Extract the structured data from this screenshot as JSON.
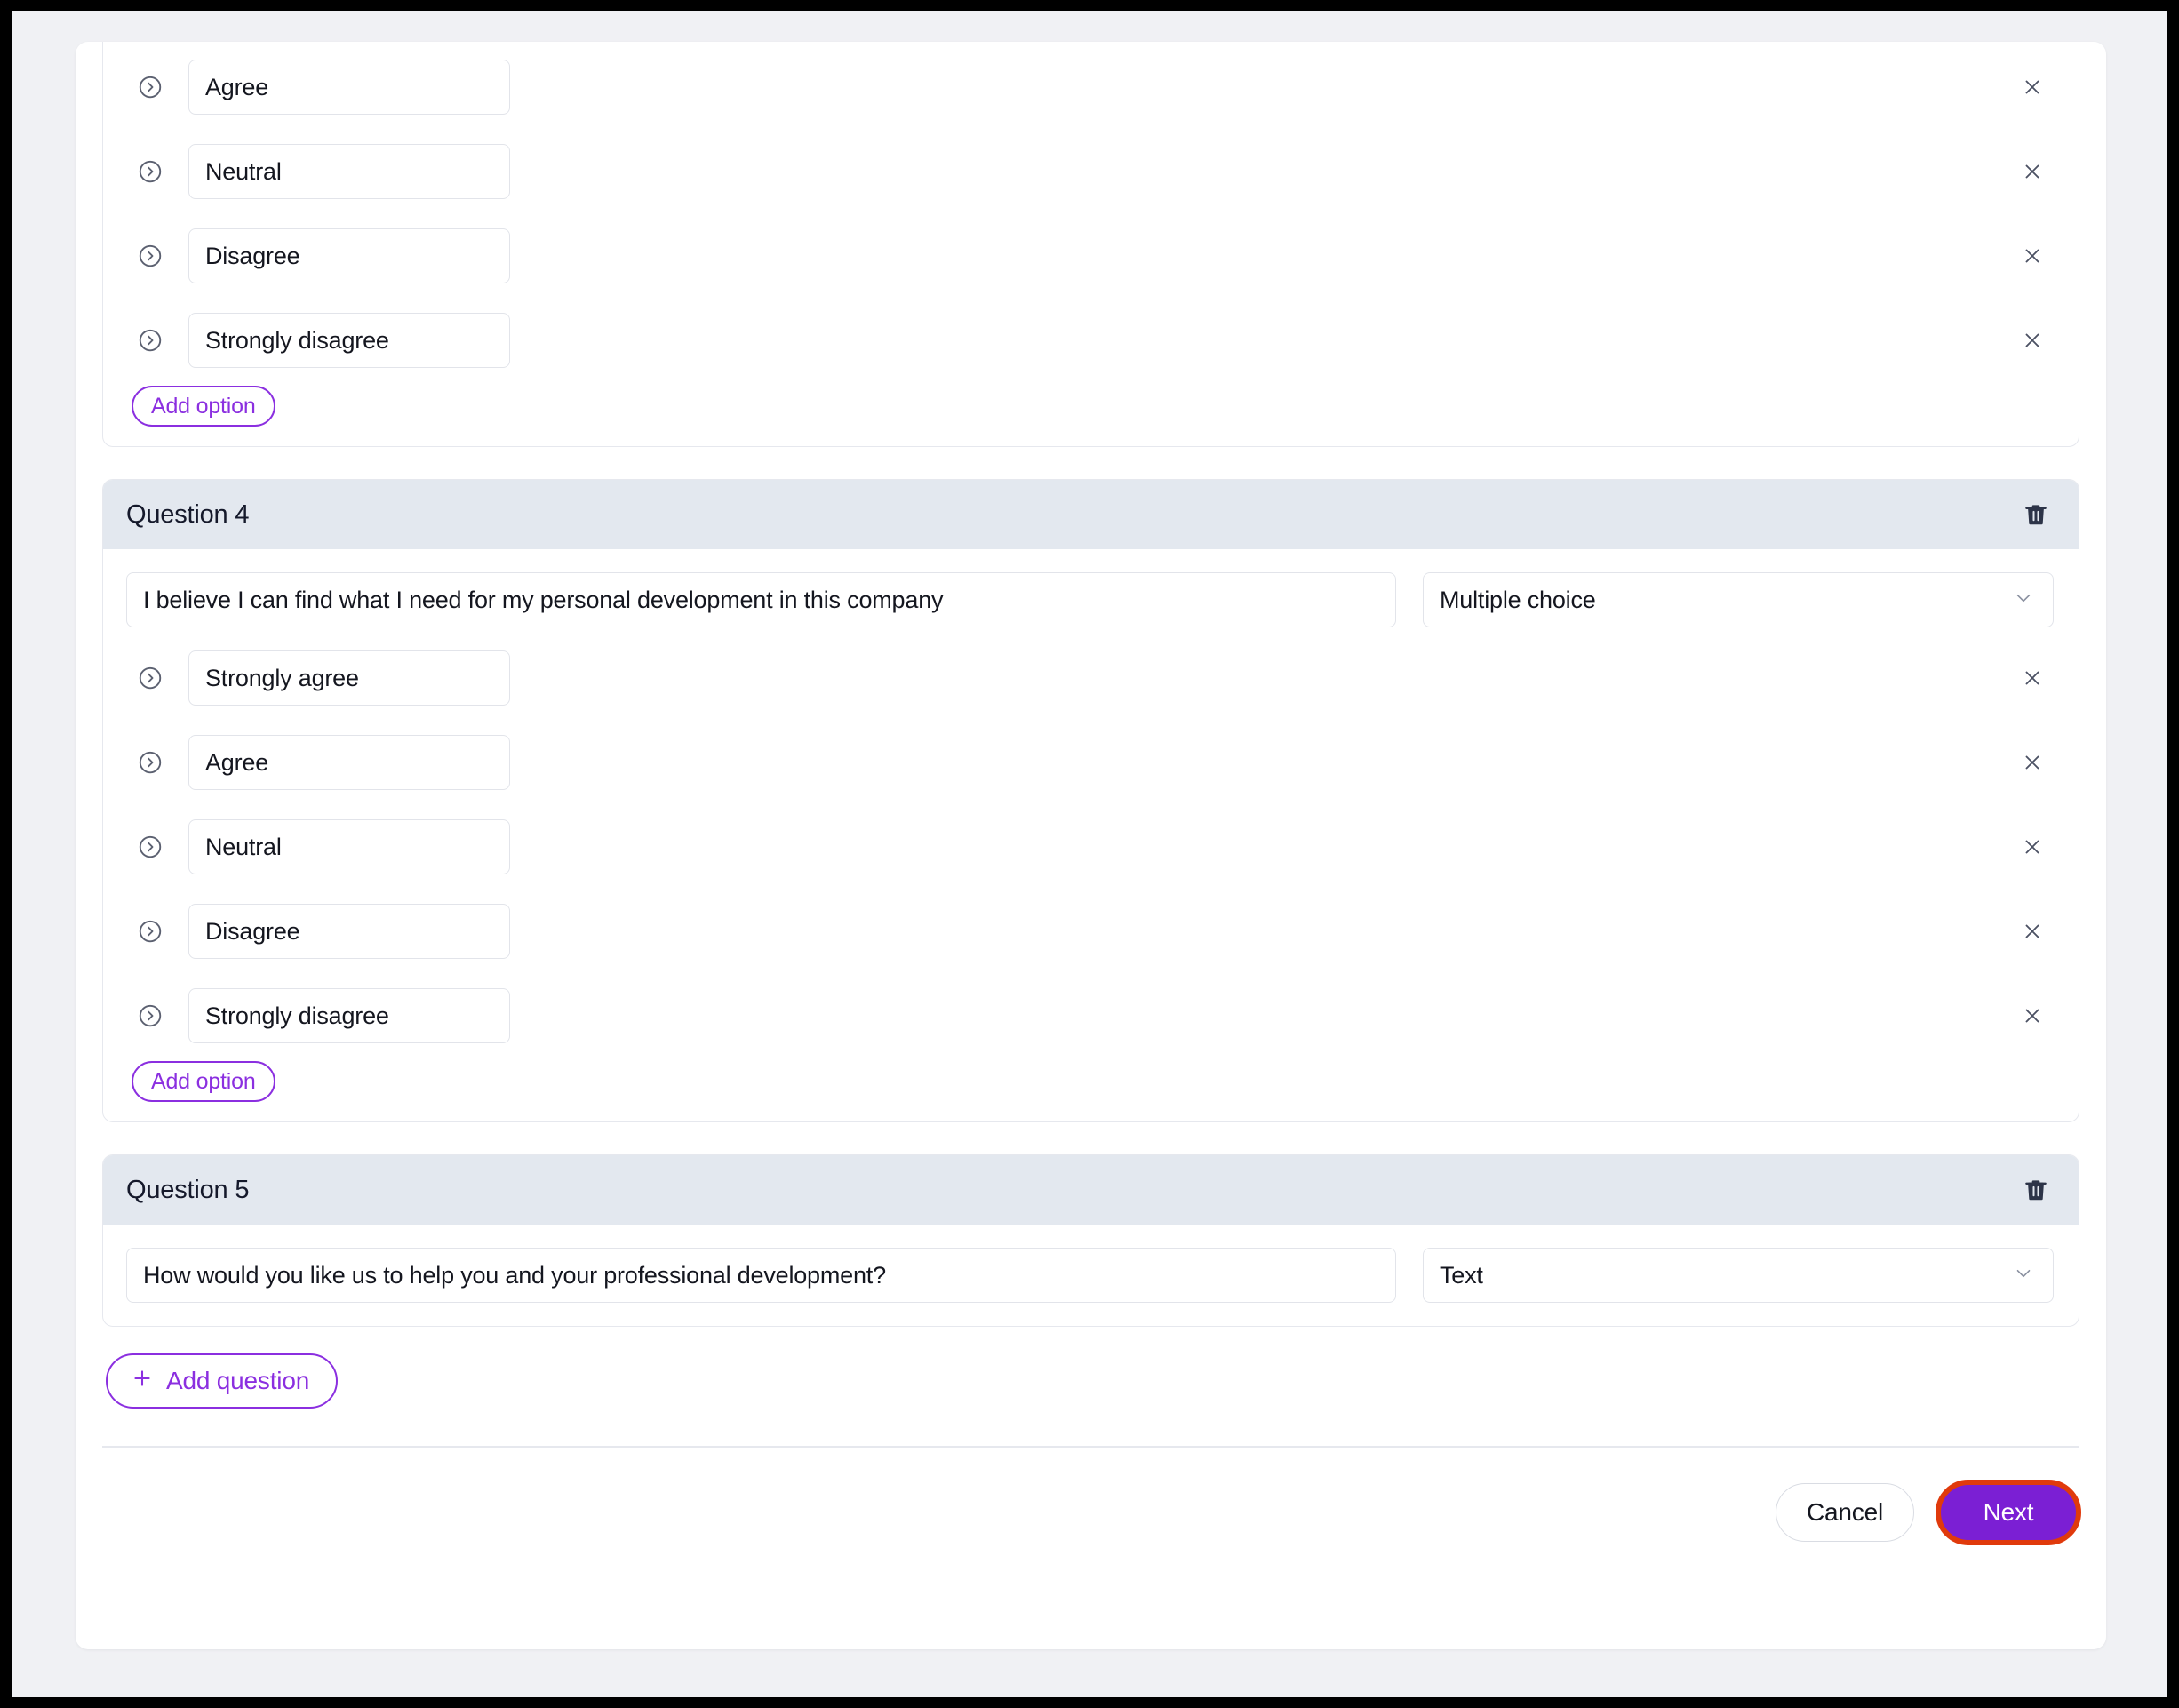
{
  "theme": {
    "accent_purple": "#8b2fe0",
    "next_button_purple": "#7b1fd4",
    "highlight_ring_red": "#e03a0c",
    "header_bg": "#e3e8ef",
    "page_bg": "#f0f1f4",
    "border": "#e2e4ea"
  },
  "questions": [
    {
      "id": "q3",
      "partial": true,
      "title": "",
      "text": "",
      "type": "",
      "options": [
        {
          "label": "Agree"
        },
        {
          "label": "Neutral"
        },
        {
          "label": "Disagree"
        },
        {
          "label": "Strongly disagree"
        }
      ],
      "add_option_label": "Add option"
    },
    {
      "id": "q4",
      "partial": false,
      "title": "Question 4",
      "text": "I believe I can find what I need for my personal development in this company",
      "type": "Multiple choice",
      "options": [
        {
          "label": "Strongly agree"
        },
        {
          "label": "Agree"
        },
        {
          "label": "Neutral"
        },
        {
          "label": "Disagree"
        },
        {
          "label": "Strongly disagree"
        }
      ],
      "add_option_label": "Add option"
    },
    {
      "id": "q5",
      "partial": false,
      "title": "Question 5",
      "text": "How would you like us to help you and your professional development?",
      "type": "Text",
      "options": [],
      "add_option_label": ""
    }
  ],
  "add_question": {
    "label": "Add question",
    "plus_icon": "plus-icon"
  },
  "footer": {
    "cancel_label": "Cancel",
    "next_label": "Next"
  },
  "icons": {
    "drag_handle": "chevron-right-circle-icon",
    "remove_option": "close-icon",
    "delete_question": "trash-icon",
    "type_dropdown": "chevron-down-icon"
  }
}
